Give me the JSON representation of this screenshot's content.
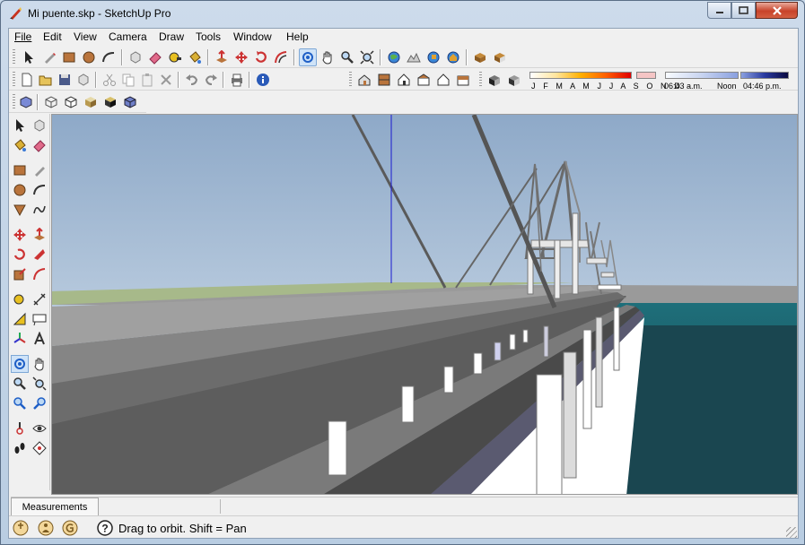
{
  "window": {
    "title": "Mi puente.skp - SketchUp Pro"
  },
  "menu": {
    "file": "File",
    "edit": "Edit",
    "view": "View",
    "camera": "Camera",
    "draw": "Draw",
    "tools": "Tools",
    "window": "Window",
    "help": "Help"
  },
  "shadows": {
    "months": "J F M A M J J A S O N D",
    "time_start": "06:43 a.m.",
    "noon": "Noon",
    "time_end": "04:46 p.m."
  },
  "measurements": {
    "label": "Measurements",
    "value": ""
  },
  "status": {
    "hint": "Drag to orbit.  Shift = Pan"
  },
  "colors": {
    "sky": "#9fb9d7",
    "water": "#1f5a66",
    "deck": "#8a8a8a",
    "active_tool": "#cfe3f8"
  },
  "icons": {
    "active_tool": "orbit-icon"
  }
}
